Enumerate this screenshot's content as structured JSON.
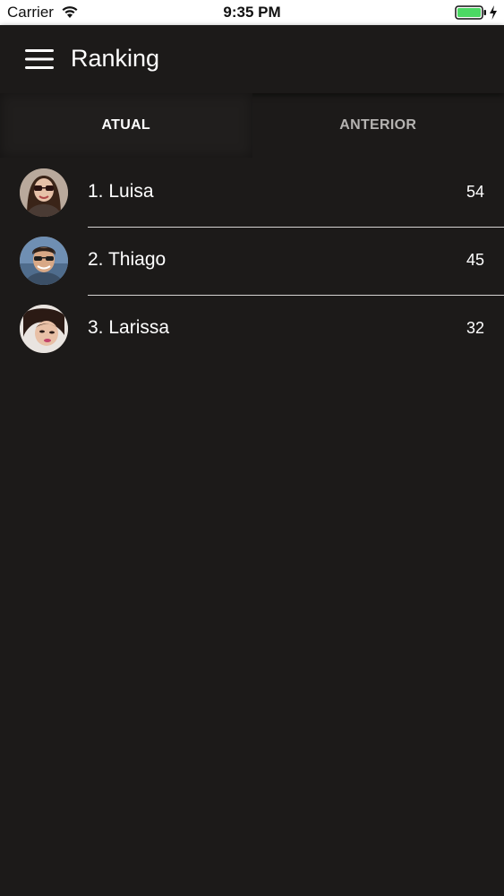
{
  "status_bar": {
    "carrier": "Carrier",
    "time": "9:35 PM",
    "battery_color": "#4cd964"
  },
  "header": {
    "title": "Ranking",
    "menu_icon": "hamburger-menu-icon"
  },
  "tabs": [
    {
      "label": "ATUAL",
      "active": true
    },
    {
      "label": "ANTERIOR",
      "active": false
    }
  ],
  "ranking": [
    {
      "name": "1. Luisa",
      "score": "54",
      "avatar": "avatar-photo"
    },
    {
      "name": "2. Thiago",
      "score": "45",
      "avatar": "avatar-photo"
    },
    {
      "name": "3. Larissa",
      "score": "32",
      "avatar": "avatar-photo"
    }
  ],
  "colors": {
    "background": "#1c1a19",
    "text": "#ffffff",
    "inactive_tab": "#b5b3b1",
    "divider": "#d6d4d2"
  }
}
